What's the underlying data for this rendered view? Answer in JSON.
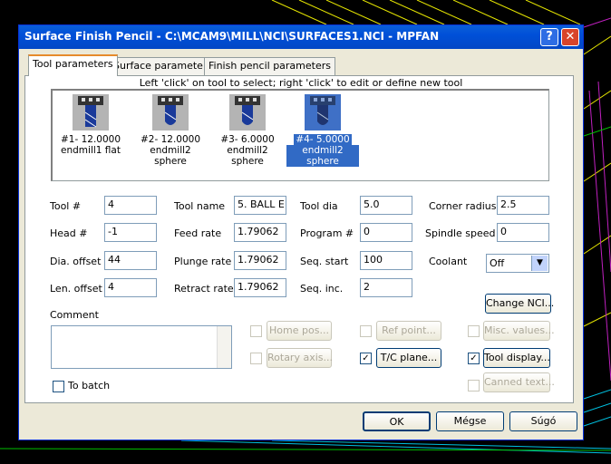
{
  "window": {
    "title": "Surface Finish Pencil - C:\\MCAM9\\MILL\\NCI\\SURFACES1.NCI - MPFAN"
  },
  "tabs": [
    "Tool parameters",
    "Surface parameters",
    "Finish pencil parameters"
  ],
  "hint": "Left 'click' on tool to select; right 'click' to edit or define new tool",
  "tools": [
    {
      "line1": "#1- 12.0000",
      "line2": "endmill1 flat"
    },
    {
      "line1": "#2- 12.0000",
      "line2": "endmill2 sphere"
    },
    {
      "line1": "#3- 6.0000",
      "line2": "endmill2 sphere"
    },
    {
      "line1": "#4- 5.0000",
      "line2": "endmill2 sphere"
    }
  ],
  "fields": {
    "tool_num": {
      "label": "Tool #",
      "value": "4"
    },
    "head_num": {
      "label": "Head #",
      "value": "-1"
    },
    "dia_offset": {
      "label": "Dia. offset",
      "value": "44"
    },
    "len_offset": {
      "label": "Len. offset",
      "value": "4"
    },
    "tool_name": {
      "label": "Tool name",
      "value": "5. BALL E"
    },
    "feed_rate": {
      "label": "Feed rate",
      "value": "1.79062"
    },
    "plunge_rate": {
      "label": "Plunge rate",
      "value": "1.79062"
    },
    "retract_rate": {
      "label": "Retract rate",
      "value": "1.79062"
    },
    "tool_dia": {
      "label": "Tool dia",
      "value": "5.0"
    },
    "program_num": {
      "label": "Program #",
      "value": "0"
    },
    "seq_start": {
      "label": "Seq. start",
      "value": "100"
    },
    "seq_inc": {
      "label": "Seq. inc.",
      "value": "2"
    },
    "corner_radius": {
      "label": "Corner radius",
      "value": "2.5"
    },
    "spindle_speed": {
      "label": "Spindle speed",
      "value": "0"
    },
    "coolant": {
      "label": "Coolant",
      "value": "Off"
    }
  },
  "comment_label": "Comment",
  "buttons": {
    "change_nci": "Change NCI...",
    "home_pos": "Home pos...",
    "ref_point": "Ref point...",
    "misc_values": "Misc. values...",
    "rotary_axis": "Rotary axis...",
    "tc_plane": "T/C plane...",
    "tool_display": "Tool display...",
    "canned_text": "Canned text..."
  },
  "to_batch": "To batch",
  "footer": {
    "ok": "OK",
    "cancel": "Mégse",
    "help": "Súgó"
  },
  "colors": {
    "accent": "#316ac5",
    "title_bar": "#0050d8"
  }
}
